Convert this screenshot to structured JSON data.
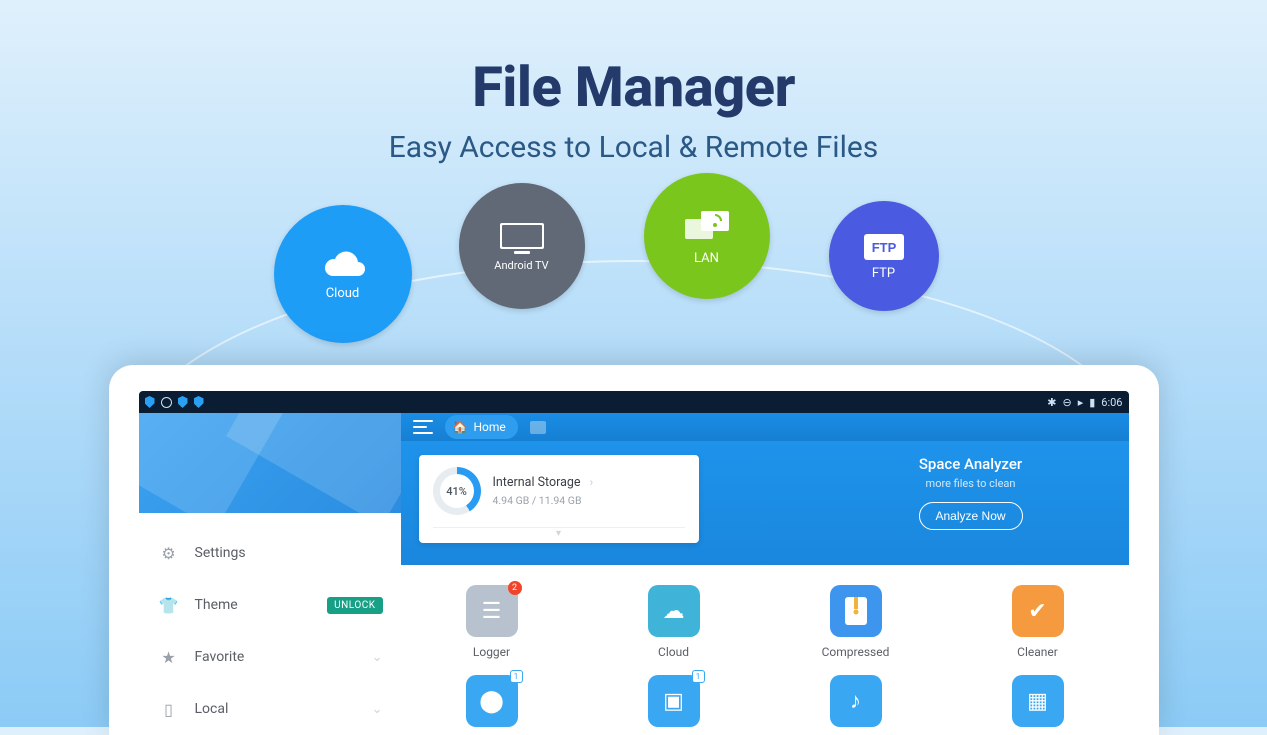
{
  "hero": {
    "title": "File Manager",
    "subtitle": "Easy Access to Local & Remote Files"
  },
  "bubbles": {
    "cloud": "Cloud",
    "tv": "Android TV",
    "lan": "LAN",
    "ftp": "FTP"
  },
  "statusbar": {
    "time": "6:06"
  },
  "topbar": {
    "home": "Home"
  },
  "storage": {
    "percent": "41%",
    "title": "Internal Storage",
    "used": "4.94 GB / 11.94 GB"
  },
  "analyzer": {
    "title": "Space Analyzer",
    "subtitle": "more files to clean",
    "button": "Analyze Now"
  },
  "sidebar": {
    "settings": "Settings",
    "theme": "Theme",
    "unlock": "UNLOCK",
    "favorite": "Favorite",
    "local": "Local"
  },
  "tiles": {
    "logger": {
      "label": "Logger",
      "badge": "2",
      "color": "#b8c2cf"
    },
    "cloud": {
      "label": "Cloud",
      "badge": "",
      "color": "#3fb4d8"
    },
    "compressed": {
      "label": "Compressed",
      "badge": "",
      "color": "#3d95ee"
    },
    "cleaner": {
      "label": "Cleaner",
      "badge": "",
      "color": "#f59a3e"
    },
    "apps": {
      "label": "",
      "badge": "1",
      "color": "#3aa7f2"
    },
    "images": {
      "label": "",
      "badge": "1",
      "color": "#3aa7f2"
    },
    "music": {
      "label": "",
      "badge": "",
      "color": "#3aa7f2"
    },
    "movies": {
      "label": "",
      "badge": "",
      "color": "#3aa7f2"
    }
  }
}
